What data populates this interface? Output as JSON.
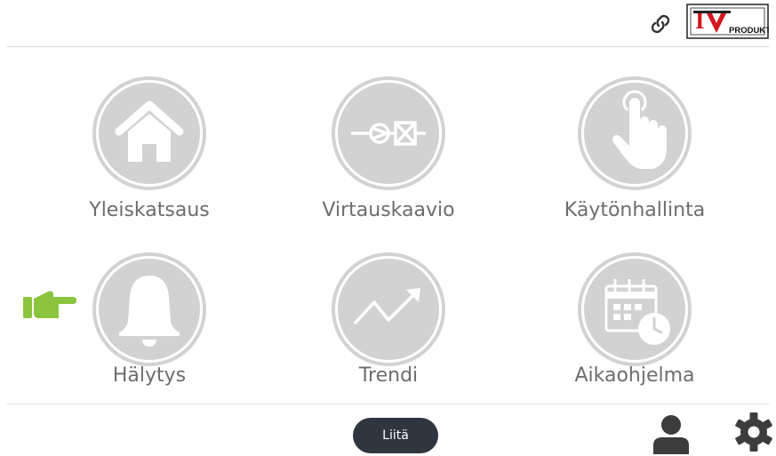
{
  "logo": {
    "letters": "IV",
    "word": "PRODUKT"
  },
  "tiles": [
    {
      "label": "Yleiskatsaus",
      "icon": "home-icon"
    },
    {
      "label": "Virtauskaavio",
      "icon": "flow-diagram-icon"
    },
    {
      "label": "Käytönhallinta",
      "icon": "touch-hand-icon"
    },
    {
      "label": "Hälytys",
      "icon": "bell-icon"
    },
    {
      "label": "Trendi",
      "icon": "trend-chart-icon"
    },
    {
      "label": "Aikaohjelma",
      "icon": "calendar-clock-icon"
    }
  ],
  "footer": {
    "attach_label": "Liitä"
  },
  "colors": {
    "tile_bg": "#d2d2d2",
    "pointer": "#8bc53f",
    "button_bg": "#2f3640",
    "icon_dark": "#4a4a4a"
  }
}
